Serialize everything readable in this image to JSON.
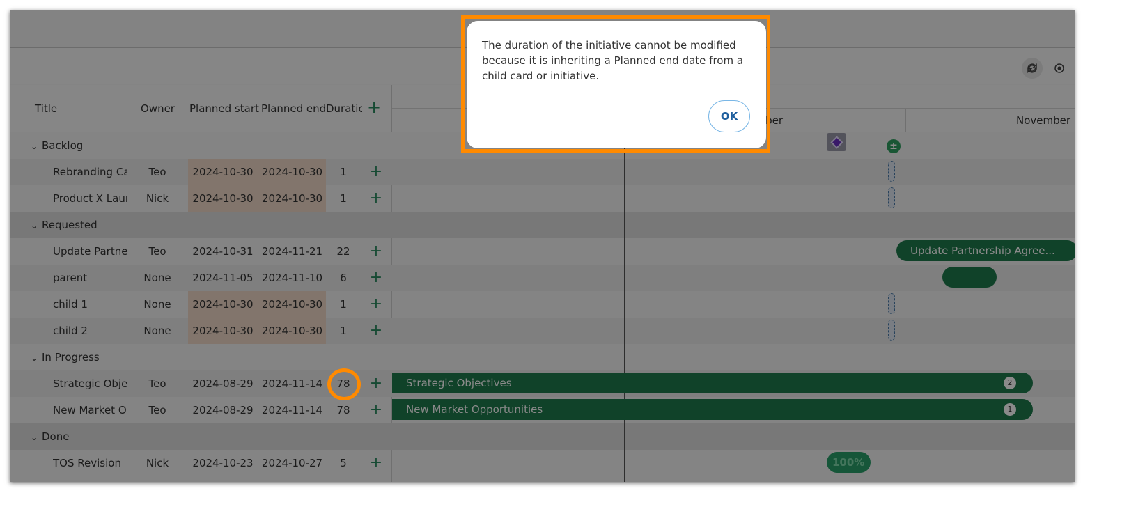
{
  "toolbar": {
    "refresh_icon": "refresh-icon",
    "target_icon": "target-icon"
  },
  "grid": {
    "columns": {
      "title": "Title",
      "owner": "Owner",
      "planned_start": "Planned start",
      "planned_end": "Planned end",
      "duration": "Duratic",
      "add": "+"
    },
    "groups": [
      {
        "name": "Backlog",
        "rows": [
          {
            "title": "Rebranding Ca",
            "owner": "Teo",
            "start": "2024-10-30",
            "end": "2024-10-30",
            "duration": "1"
          },
          {
            "title": "Product X Laun",
            "owner": "Nick",
            "start": "2024-10-30",
            "end": "2024-10-30",
            "duration": "1"
          }
        ]
      },
      {
        "name": "Requested",
        "rows": [
          {
            "title": "Update Partner",
            "owner": "Teo",
            "start": "2024-10-31",
            "end": "2024-11-21",
            "duration": "22"
          },
          {
            "title": "parent",
            "owner": "None",
            "start": "2024-11-05",
            "end": "2024-11-10",
            "duration": "6"
          },
          {
            "title": "child 1",
            "owner": "None",
            "start": "2024-10-30",
            "end": "2024-10-30",
            "duration": "1"
          },
          {
            "title": "child 2",
            "owner": "None",
            "start": "2024-10-30",
            "end": "2024-10-30",
            "duration": "1"
          }
        ]
      },
      {
        "name": "In Progress",
        "rows": [
          {
            "title": "Strategic Objec",
            "owner": "Teo",
            "start": "2024-08-29",
            "end": "2024-11-14",
            "duration": "78"
          },
          {
            "title": "New Market Op",
            "owner": "Teo",
            "start": "2024-08-29",
            "end": "2024-11-14",
            "duration": "78"
          }
        ]
      },
      {
        "name": "Done",
        "rows": [
          {
            "title": "TOS Revision",
            "owner": "Nick",
            "start": "2024-10-23",
            "end": "2024-10-27",
            "duration": "5"
          }
        ]
      }
    ]
  },
  "timeline": {
    "months": {
      "partial": "ober",
      "november": "November"
    },
    "bars": {
      "update_partnership": "Update Partnership Agree...",
      "strategic_objectives": "Strategic Objectives",
      "strategic_badge": "2",
      "new_market": "New Market Opportunities",
      "new_market_badge": "1",
      "tos_progress": "100%"
    },
    "today_marker": "±"
  },
  "dialog": {
    "message": "The duration of the initiative cannot be modified because it is inheriting a Planned end date from a child card or initiative.",
    "ok_label": "OK"
  },
  "colors": {
    "accent": "#1f7a4d",
    "highlight": "#ff8a00",
    "date_highlight": "#f0d9c8"
  }
}
